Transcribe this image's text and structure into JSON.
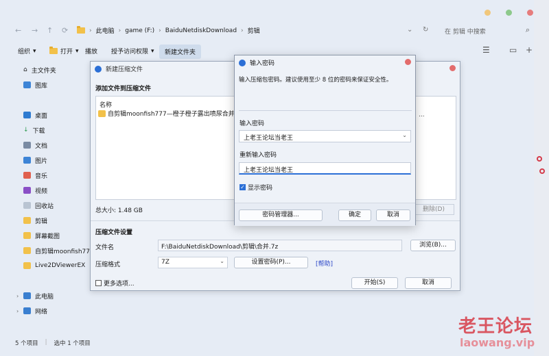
{
  "explorer": {
    "breadcrumb": [
      "此电脑",
      "game (F:)",
      "BaiduNetdiskDownload",
      "剪辑"
    ],
    "search_placeholder": "在 剪辑 中搜索",
    "commands": {
      "organize": "组织",
      "open": "打开",
      "play": "播放",
      "share": "授予访问权限",
      "new_folder": "新建文件夹"
    },
    "sidebar": [
      {
        "label": "主文件夹",
        "icon": "home-icon"
      },
      {
        "label": "图库",
        "icon": "gallery-icon"
      },
      {
        "label": "桌面",
        "icon": "desktop-icon"
      },
      {
        "label": "下载",
        "icon": "download-icon"
      },
      {
        "label": "文档",
        "icon": "document-icon"
      },
      {
        "label": "图片",
        "icon": "picture-icon"
      },
      {
        "label": "音乐",
        "icon": "music-icon"
      },
      {
        "label": "视频",
        "icon": "video-icon"
      },
      {
        "label": "回收站",
        "icon": "recycle-bin-icon"
      },
      {
        "label": "剪辑",
        "icon": "folder-icon"
      },
      {
        "label": "屏幕截图",
        "icon": "folder-icon"
      },
      {
        "label": "自剪辑moonfish777-",
        "icon": "folder-icon"
      },
      {
        "label": "Live2DViewerEX",
        "icon": "folder-icon"
      },
      {
        "label": "此电脑",
        "icon": "pc-icon"
      },
      {
        "label": "网络",
        "icon": "network-icon"
      }
    ],
    "status": {
      "count": "5 个项目",
      "selected": "选中 1 个项目"
    }
  },
  "archive": {
    "title": "新建压缩文件",
    "section_add": "添加文件到压缩文件",
    "col_name": "名称",
    "file_name": "自剪辑moonfish777—橙子橙子露出喷尿合并",
    "file_trail": "...",
    "total": "总大小: 1.48 GB",
    "delete_btn": "删除(D)",
    "section_settings": "压缩文件设置",
    "label_filename": "文件名",
    "filename_value": "F:\\BaiduNetdiskDownload\\剪辑\\合并.7z",
    "browse_btn": "浏览(B)...",
    "label_format": "压缩格式",
    "format_value": "7Z",
    "set_password_btn": "设置密码(P)...",
    "help_link": "[帮助]",
    "more_options": "更多选项...",
    "start_btn": "开始(S)",
    "cancel_btn": "取消"
  },
  "password": {
    "title": "输入密码",
    "hint": "输入压缩包密码。建议使用至少 8 位的密码来保证安全性。",
    "label_enter": "输入密码",
    "enter_value": "上老王论坛当老王",
    "label_reenter": "重新输入密码",
    "reenter_value": "上老王论坛当老王",
    "show_password": "显示密码",
    "manager_btn": "密码管理器...",
    "ok_btn": "确定",
    "cancel_btn": "取消"
  },
  "watermark": {
    "line1": "老王论坛",
    "line2": "laowang.vip"
  },
  "colors": {
    "accent": "#2b6fd6",
    "close": "#e36c6c",
    "watermark": "#d63c46"
  }
}
